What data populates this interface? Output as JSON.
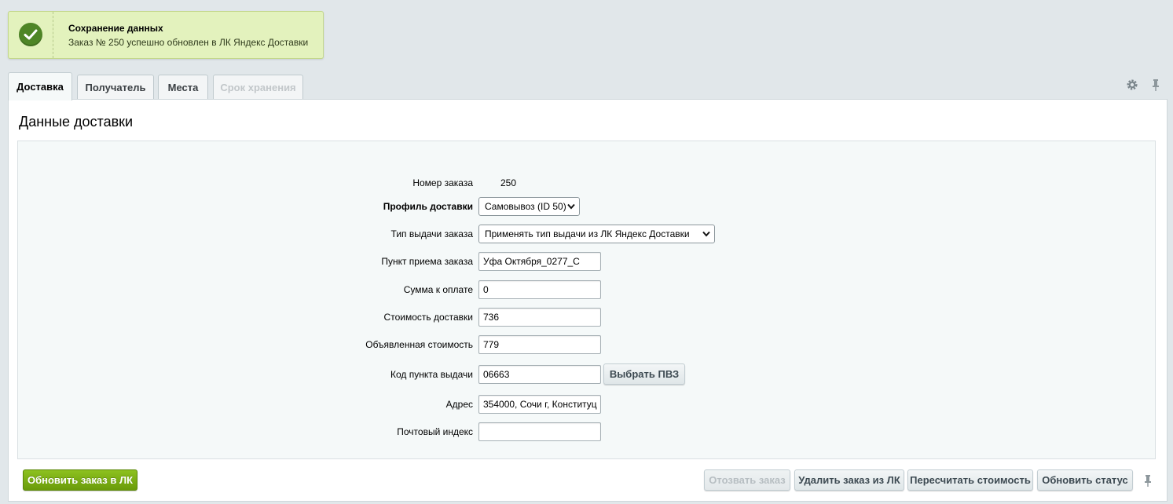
{
  "notification": {
    "title": "Сохранение данных",
    "message": "Заказ № 250 успешно обновлен в ЛК Яндекс Доставки",
    "icon": "check-circle-icon",
    "color": "#4e8526"
  },
  "tabs": [
    {
      "label": "Доставка",
      "active": true
    },
    {
      "label": "Получатель",
      "active": false
    },
    {
      "label": "Места",
      "active": false
    },
    {
      "label": "Срок хранения",
      "active": false,
      "disabled": true
    }
  ],
  "toolbar_icons": [
    "gear-icon",
    "pin-icon"
  ],
  "panel": {
    "title": "Данные доставки"
  },
  "form": {
    "order_number": {
      "label": "Номер заказа",
      "value": "250"
    },
    "delivery_profile": {
      "label": "Профиль доставки",
      "value": "Самовывоз (ID 50)"
    },
    "issue_type": {
      "label": "Тип выдачи заказа",
      "value": "Применять тип выдачи из ЛК Яндекс Доставки"
    },
    "intake_point": {
      "label": "Пункт приема заказа",
      "value": "Уфа Октября_0277_С"
    },
    "amount_due": {
      "label": "Сумма к оплате",
      "value": "0"
    },
    "delivery_cost": {
      "label": "Стоимость доставки",
      "value": "736"
    },
    "declared_value": {
      "label": "Объявленная стоимость",
      "value": "779"
    },
    "pickup_code": {
      "label": "Код пункта выдачи",
      "value": "06663",
      "button": "Выбрать ПВЗ"
    },
    "address": {
      "label": "Адрес",
      "value": "354000, Сочи г, Конституц"
    },
    "postcode": {
      "label": "Почтовый индекс",
      "value": ""
    }
  },
  "footer": {
    "update_button": "Обновить заказ в ЛК",
    "recall_button": "Отозвать заказ",
    "delete_button": "Удалить заказ из ЛК",
    "recalc_button": "Пересчитать стоимость",
    "status_button": "Обновить статус"
  }
}
